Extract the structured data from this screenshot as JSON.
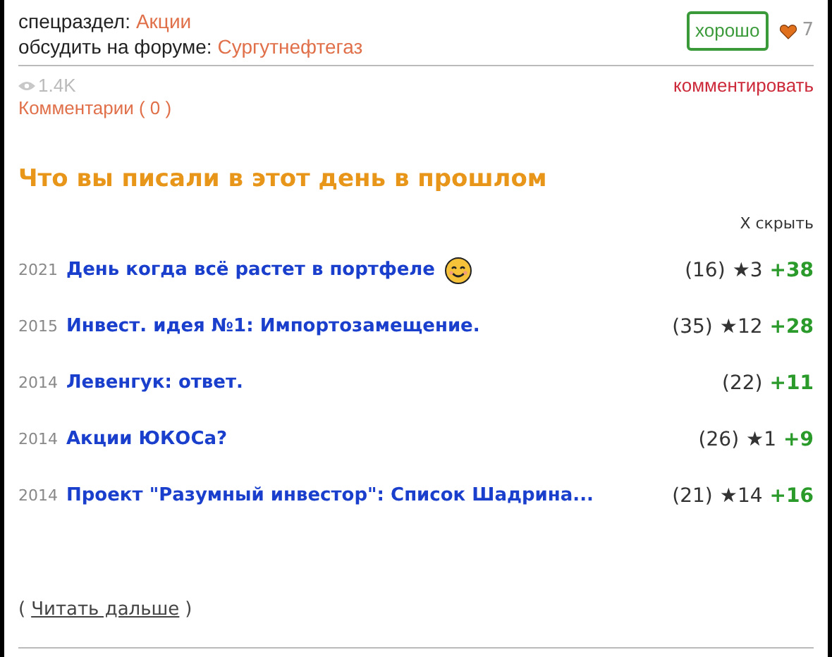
{
  "meta": {
    "section_label": "спецраздел:",
    "section": "Акции",
    "forum_label": "обсудить на форуме:",
    "forum": "Сургутнефтегаз",
    "good_button": "хорошо",
    "likes": "7"
  },
  "stats": {
    "views": "1.4K",
    "comments": "Комментарии ( 0 )",
    "comment_link": "комментировать"
  },
  "history": {
    "title": "Что вы писали в этот день в прошлом",
    "hide": "X скрыть",
    "posts": [
      {
        "year": "2021",
        "title": "День когда всё растет в портфеле",
        "smiley": true,
        "comments": "(16)",
        "rating": "★3",
        "plus": "+38"
      },
      {
        "year": "2015",
        "title": "Инвест. идея №1: Импортозамещение.",
        "smiley": false,
        "comments": "(35)",
        "rating": "★12",
        "plus": "+28"
      },
      {
        "year": "2014",
        "title": "Левенгук: ответ.",
        "smiley": false,
        "comments": "(22)",
        "plus": "+11"
      },
      {
        "year": "2014",
        "title": "Акции ЮКОСа?",
        "smiley": false,
        "comments": "(26)",
        "rating": "★1",
        "plus": "+9"
      },
      {
        "year": "2014",
        "title": "Проект \"Разумный инвестор\": Список Шадрина...",
        "smiley": false,
        "comments": "(21)",
        "rating": "★14",
        "plus": "+16"
      }
    ],
    "more_open": "(",
    "more": "Читать дальше",
    "more_close": ")"
  }
}
